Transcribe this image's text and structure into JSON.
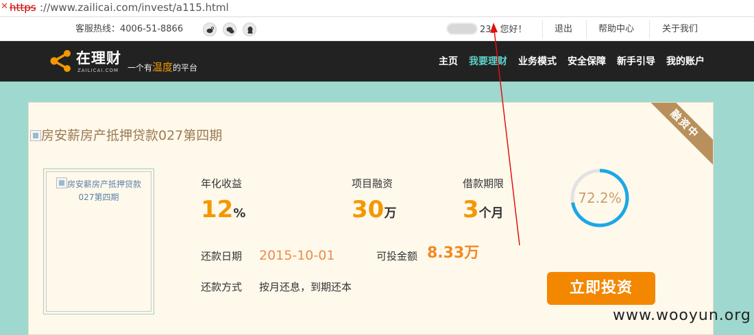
{
  "browser": {
    "url_scheme": "https",
    "url_rest": "://www.zailicai.com/invest/a115.html"
  },
  "topbar": {
    "hotline": "客服热线：4006-51-8866",
    "social_icons": [
      "weibo-icon",
      "wechat-icon",
      "qq-icon"
    ],
    "welcome_suffix": "23，您好！",
    "links": [
      "退出",
      "帮助中心",
      "关于我们"
    ]
  },
  "header": {
    "logo_name": "在理财",
    "logo_domain": "ZAILICAI.COM",
    "slogan_pre": "一个有",
    "slogan_highlight": "温度",
    "slogan_post": "的平台",
    "nav": [
      "主页",
      "我要理财",
      "业务模式",
      "安全保障",
      "新手引导",
      "我的账户"
    ],
    "nav_active": "我要理财"
  },
  "project": {
    "status_ribbon": "融资中",
    "title_alt": "房安薪房产抵押贷款027第四期",
    "thumb_alt": "房安薪房产抵押贷款027第四期",
    "annual_yield_label": "年化收益",
    "annual_yield_value": "12",
    "annual_yield_unit": "%",
    "financing_label": "项目融资",
    "financing_value": "30",
    "financing_unit": "万",
    "term_label": "借款期限",
    "term_value": "3",
    "term_unit": "个月",
    "repay_date_label": "还款日期",
    "repay_date_value": "2015-10-01",
    "available_label": "可投金额",
    "available_value": "8.33万",
    "repay_method_label": "还款方式",
    "repay_method_value": "按月还息，到期还本",
    "progress_percent": 72.2,
    "progress_text": "72.2%",
    "invest_button": "立即投资"
  },
  "colors": {
    "accent_orange": "#f39800",
    "header_bg": "#222222",
    "band_teal": "#9fd8cf",
    "nav_active": "#5cd1c8",
    "ring_blue": "#1aa8e6"
  },
  "watermark": "www.wooyun.org"
}
